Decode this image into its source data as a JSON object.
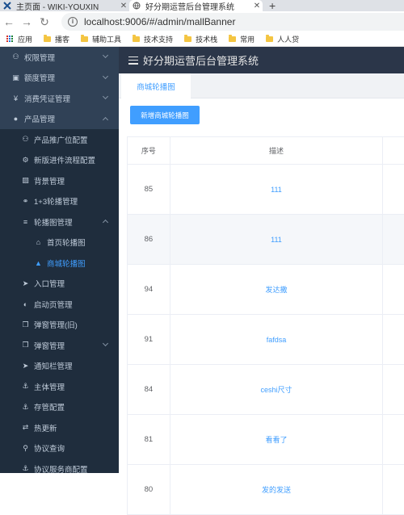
{
  "browser": {
    "tabs": [
      {
        "title": "主页面 - WIKI-YOUXIN",
        "icon": "x-logo-icon",
        "active": false
      },
      {
        "title": "好分期运营后台管理系统",
        "icon": "globe-icon",
        "active": true
      }
    ],
    "url": "localhost:9006/#/admin/mallBanner",
    "bookmarks": [
      {
        "label": "应用",
        "icon": "apps-icon"
      },
      {
        "label": "播客",
        "icon": "folder-icon"
      },
      {
        "label": "辅助工具",
        "icon": "folder-icon"
      },
      {
        "label": "技术支持",
        "icon": "folder-icon"
      },
      {
        "label": "技术栈",
        "icon": "folder-icon"
      },
      {
        "label": "常用",
        "icon": "folder-icon"
      },
      {
        "label": "人人贷",
        "icon": "folder-icon"
      }
    ]
  },
  "header": {
    "title": "好分期运营后台管理系统"
  },
  "sidebar": {
    "items": [
      {
        "label": "权限管理",
        "level": 0,
        "icon": "sitemap-icon",
        "arrow": "down"
      },
      {
        "label": "额度管理",
        "level": 0,
        "icon": "money-icon",
        "arrow": "down"
      },
      {
        "label": "消费凭证管理",
        "level": 0,
        "icon": "yen-icon",
        "arrow": "down"
      },
      {
        "label": "产品管理",
        "level": 0,
        "icon": "product-icon",
        "arrow": "up"
      },
      {
        "label": "产品推广位配置",
        "level": 1,
        "icon": "sitemap-icon"
      },
      {
        "label": "新版进件流程配置",
        "level": 1,
        "icon": "gear-icon"
      },
      {
        "label": "背景管理",
        "level": 1,
        "icon": "image-icon"
      },
      {
        "label": "1+3轮播管理",
        "level": 1,
        "icon": "users-icon"
      },
      {
        "label": "轮播图管理",
        "level": 1,
        "icon": "sliders-icon",
        "arrow": "up"
      },
      {
        "label": "首页轮播图",
        "level": 2,
        "icon": "home-icon"
      },
      {
        "label": "商城轮播图",
        "level": 2,
        "icon": "bank-icon",
        "active": true
      },
      {
        "label": "入口管理",
        "level": 1,
        "icon": "send-icon"
      },
      {
        "label": "启动页管理",
        "level": 1,
        "icon": "toggle-icon"
      },
      {
        "label": "弹窗管理(旧)",
        "level": 1,
        "icon": "clone-icon"
      },
      {
        "label": "弹窗管理",
        "level": 1,
        "icon": "clone-icon",
        "arrow": "down"
      },
      {
        "label": "通知栏管理",
        "level": 1,
        "icon": "send-icon"
      },
      {
        "label": "主体管理",
        "level": 1,
        "icon": "anchor-icon"
      },
      {
        "label": "存管配置",
        "level": 1,
        "icon": "anchor-icon"
      },
      {
        "label": "热更新",
        "level": 1,
        "icon": "exchange-icon"
      },
      {
        "label": "协议查询",
        "level": 1,
        "icon": "search-icon"
      },
      {
        "label": "协议服务商配置",
        "level": 1,
        "icon": "anchor-icon"
      }
    ]
  },
  "page_tab": {
    "label": "商城轮播图"
  },
  "add_button": {
    "label": "新增商城轮播图"
  },
  "table": {
    "headers": {
      "no": "序号",
      "desc": "描述"
    },
    "rows": [
      {
        "no": "85",
        "desc": "111"
      },
      {
        "no": "86",
        "desc": "111"
      },
      {
        "no": "94",
        "desc": "发达撒"
      },
      {
        "no": "91",
        "desc": "fafdsa"
      },
      {
        "no": "84",
        "desc": "ceshi尺寸"
      },
      {
        "no": "81",
        "desc": "看看了"
      },
      {
        "no": "80",
        "desc": "发的发送"
      }
    ]
  },
  "colors": {
    "sidebar_bg": "#304156",
    "submenu_bg": "#1f2d3d",
    "accent": "#409eff",
    "header_bg": "#2b3649"
  }
}
